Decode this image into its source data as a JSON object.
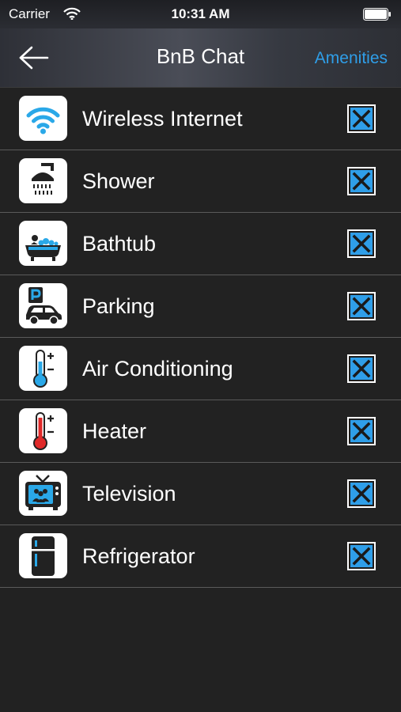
{
  "status_bar": {
    "carrier": "Carrier",
    "time": "10:31 AM"
  },
  "nav": {
    "title": "BnB Chat",
    "action": "Amenities",
    "back_icon": "back-arrow-icon"
  },
  "colors": {
    "accent": "#2f9ee8",
    "background": "#222222",
    "divider": "#5a5a5a"
  },
  "amenities": [
    {
      "label": "Wireless Internet",
      "icon": "wifi-icon",
      "checked": true
    },
    {
      "label": "Shower",
      "icon": "shower-icon",
      "checked": true
    },
    {
      "label": "Bathtub",
      "icon": "bathtub-icon",
      "checked": true
    },
    {
      "label": "Parking",
      "icon": "parking-icon",
      "checked": true
    },
    {
      "label": "Air Conditioning",
      "icon": "thermometer-cold-icon",
      "checked": true
    },
    {
      "label": "Heater",
      "icon": "thermometer-hot-icon",
      "checked": true
    },
    {
      "label": "Television",
      "icon": "television-icon",
      "checked": true
    },
    {
      "label": "Refrigerator",
      "icon": "refrigerator-icon",
      "checked": true
    }
  ]
}
